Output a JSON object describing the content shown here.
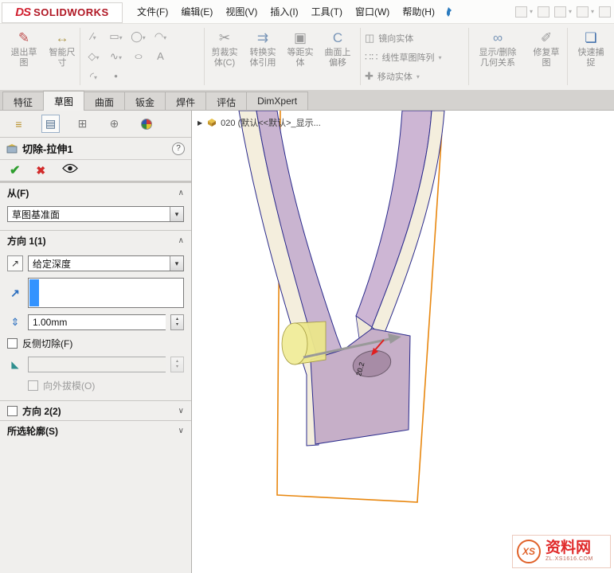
{
  "window": {
    "logo_prefix": "DS",
    "logo_text": "SOLIDWORKS"
  },
  "menu": {
    "items": [
      "文件(F)",
      "编辑(E)",
      "视图(V)",
      "插入(I)",
      "工具(T)",
      "窗口(W)",
      "帮助(H)"
    ]
  },
  "ribbon": {
    "exit_sketch": {
      "l1": "退出草",
      "l2": "图"
    },
    "smart_dimension": {
      "l1": "智能尺",
      "l2": "寸"
    },
    "trim": {
      "l1": "剪裁实",
      "l2": "体(C)"
    },
    "convert": {
      "l1": "转换实",
      "l2": "体引用"
    },
    "offset": {
      "l1": "等距实",
      "l2": "体"
    },
    "surface_offset": {
      "l1": "曲面上",
      "l2": "偏移"
    },
    "mirror": "镜向实体",
    "linear_pattern": "线性草图阵列",
    "move": "移动实体",
    "relations": {
      "l1": "显示/删除",
      "l2": "几何关系"
    },
    "repair": {
      "l1": "修复草",
      "l2": "图"
    },
    "quick_snap": {
      "l1": "快速捕",
      "l2": "捉"
    }
  },
  "tabs": {
    "items": [
      "特征",
      "草图",
      "曲面",
      "钣金",
      "焊件",
      "评估",
      "DimXpert"
    ],
    "active": "草图"
  },
  "pm": {
    "title": "切除-拉伸1",
    "help": "?",
    "from_label": "从(F)",
    "from_value": "草图基准面",
    "dir1_label": "方向 1(1)",
    "dir1_end_condition": "给定深度",
    "depth_value": "1.00mm",
    "flip_label": "反侧切除(F)",
    "draft_out_label": "向外拔模(O)",
    "dir2_label": "方向 2(2)",
    "contours_label": "所选轮廓(S)"
  },
  "viewport": {
    "breadcrumb": "020 (默认<<默认>_显示...",
    "annotation": "20.2"
  },
  "watermark": {
    "logo": "XS",
    "title": "资料网",
    "url": "ZL.XS1616.COM"
  },
  "icons": {
    "dropdown_arrow": "▾",
    "spin_up": "▴",
    "spin_down": "▾",
    "chevron_up": "∧",
    "chevron_down": "∨",
    "check": "✔",
    "cross": "✖",
    "breadcrumb_arrow": "▶",
    "exit_sketch": "✎",
    "smart_dimension": "↔",
    "line": "∕",
    "rectangle": "▭",
    "circle": "◯",
    "arc": "◠",
    "polygon": "◇",
    "spline": "∿",
    "ellipse": "○",
    "text_tool": "A",
    "fillet": "◜",
    "point": "•",
    "trim": "✂",
    "convert": "⇉",
    "offset": "▣",
    "surface_offset": "C",
    "mirror": "◫",
    "linear_pattern": "∷∷",
    "move": "✚",
    "relations": "∞",
    "repair": "✐",
    "quick_snap": "❏",
    "direction_arrow": "↗",
    "depth": "⇕",
    "draft": "◣",
    "feature_tree": "≡",
    "property_tab": "▤",
    "config_tab": "⊞",
    "dimxpert_tab": "⊕"
  },
  "colors": {
    "plane_orange": "#e8870f",
    "model_purple": "#c9b4d0",
    "preview_yellow": "#ebe68a",
    "highlight_blue": "#3393ff",
    "check_green": "#2e9e2e",
    "cross_red": "#d22b2b"
  }
}
